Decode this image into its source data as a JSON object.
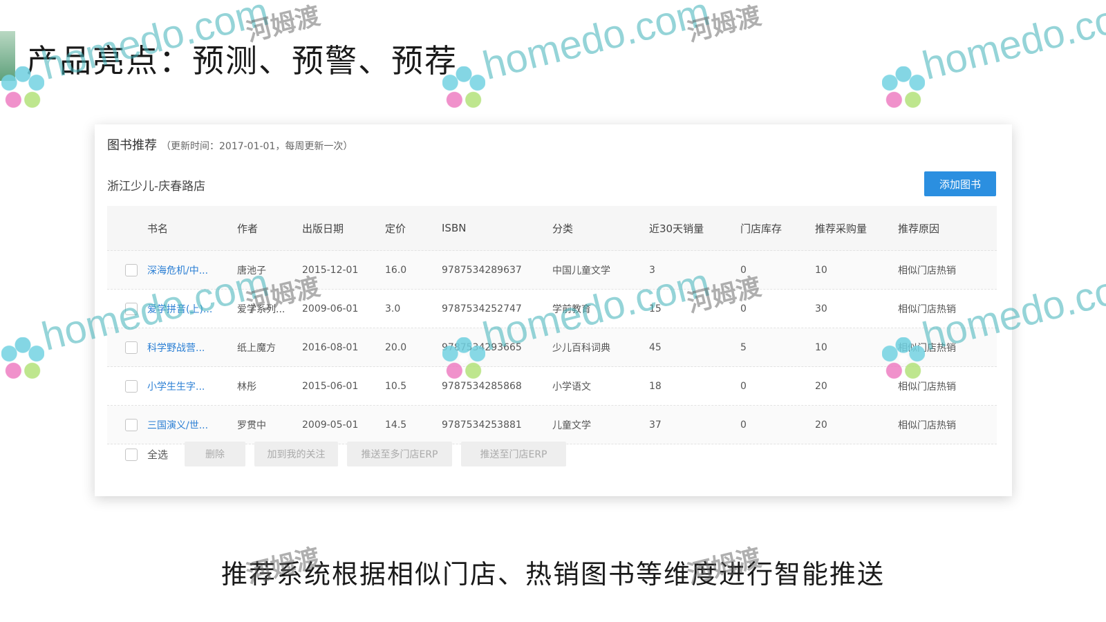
{
  "slide": {
    "title": "产品亮点：预测、预警、预荐",
    "caption": "推荐系统根据相似门店、热销图书等维度进行智能推送"
  },
  "panel": {
    "title": "图书推荐",
    "update_note": "（更新时间：2017-01-01，每周更新一次）",
    "store_name": "浙江少儿-庆春路店",
    "add_button": "添加图书"
  },
  "table": {
    "headers": {
      "title": "书名",
      "author": "作者",
      "date": "出版日期",
      "price": "定价",
      "isbn": "ISBN",
      "category": "分类",
      "sales": "近30天销量",
      "stock": "门店库存",
      "buy": "推荐采购量",
      "reason": "推荐原因"
    },
    "rows": [
      {
        "title": "深海危机/中...",
        "author": "唐池子",
        "date": "2015-12-01",
        "price": "16.0",
        "isbn": "9787534289637",
        "category": "中国儿童文学",
        "sales": "3",
        "stock": "0",
        "buy": "10",
        "reason": "相似门店热销"
      },
      {
        "title": "爱学拼音(上)...",
        "author": "爱学系列...",
        "date": "2009-06-01",
        "price": "3.0",
        "isbn": "9787534252747",
        "category": "学前教育",
        "sales": "15",
        "stock": "0",
        "buy": "30",
        "reason": "相似门店热销"
      },
      {
        "title": "科学野战营...",
        "author": "纸上魔方",
        "date": "2016-08-01",
        "price": "20.0",
        "isbn": "9787534293665",
        "category": "少儿百科词典",
        "sales": "45",
        "stock": "5",
        "buy": "10",
        "reason": "相似门店热销"
      },
      {
        "title": "小学生生字...",
        "author": "林彤",
        "date": "2015-06-01",
        "price": "10.5",
        "isbn": "9787534285868",
        "category": "小学语文",
        "sales": "18",
        "stock": "0",
        "buy": "20",
        "reason": "相似门店热销"
      },
      {
        "title": "三国演义/世...",
        "author": "罗贯中",
        "date": "2009-05-01",
        "price": "14.5",
        "isbn": "9787534253881",
        "category": "儿童文学",
        "sales": "37",
        "stock": "0",
        "buy": "20",
        "reason": "相似门店热销"
      }
    ]
  },
  "footer": {
    "select_all": "全选",
    "delete": "删除",
    "add_watch": "加到我的关注",
    "push_multi": "推送至多门店ERP",
    "push_store": "推送至门店ERP"
  },
  "watermark": {
    "site": "homedo.com",
    "name": "河姆渡"
  },
  "colors": {
    "primary_button": "#2b8fe0",
    "link": "#2b7fd4",
    "accent_bar": "#5ea07a"
  }
}
